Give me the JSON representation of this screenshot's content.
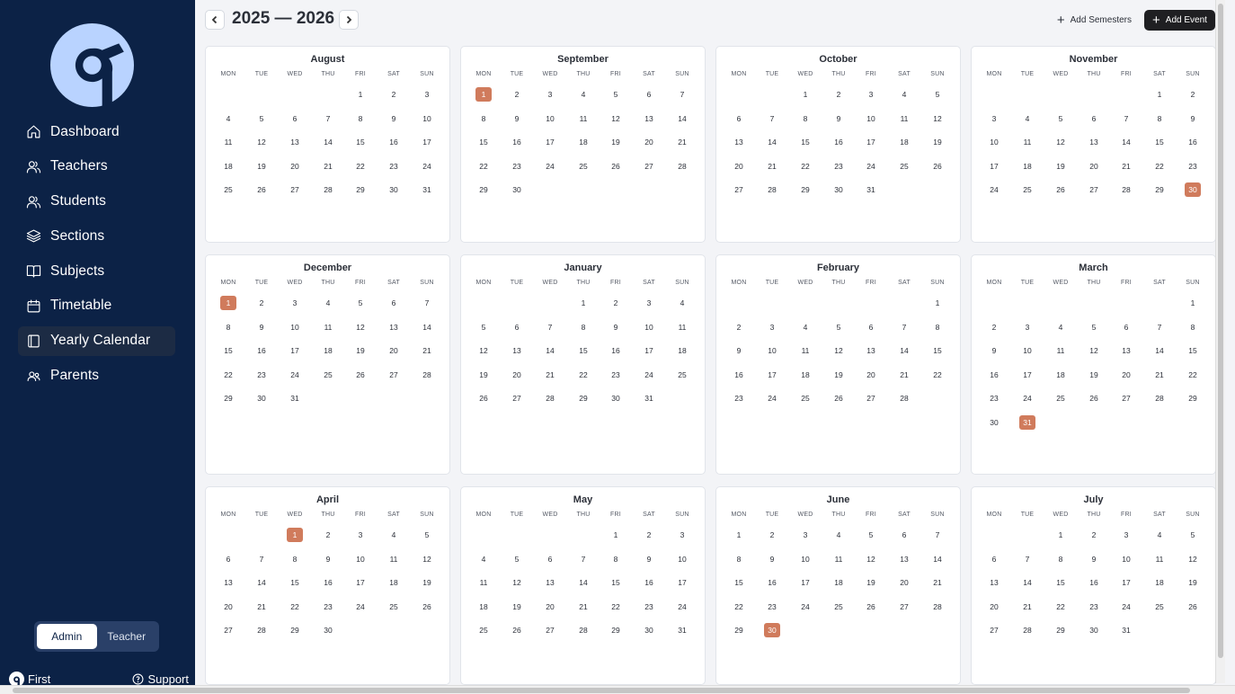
{
  "sidebar": {
    "items": [
      {
        "label": "Dashboard",
        "icon": "home-icon"
      },
      {
        "label": "Teachers",
        "icon": "users-icon"
      },
      {
        "label": "Students",
        "icon": "users-icon"
      },
      {
        "label": "Sections",
        "icon": "layers-icon"
      },
      {
        "label": "Subjects",
        "icon": "book-open-icon"
      },
      {
        "label": "Timetable",
        "icon": "calendar-icon"
      },
      {
        "label": "Yearly Calendar",
        "icon": "book-icon",
        "active": true
      },
      {
        "label": "Parents",
        "icon": "user-group-icon"
      }
    ],
    "role_toggle": {
      "admin": "Admin",
      "teacher": "Teacher",
      "selected": "Admin"
    },
    "footer": {
      "brand": "First",
      "support": "Support"
    }
  },
  "header": {
    "year_range": "2025 — 2026",
    "add_semesters": "Add Semesters",
    "add_event": "Add Event"
  },
  "weekdays": [
    "MON",
    "TUE",
    "WED",
    "THU",
    "FRI",
    "SAT",
    "SUN"
  ],
  "colors": {
    "sidebar": "#0c2246",
    "highlight": "#d07b5c",
    "primary_button": "#1f1f22"
  },
  "months": [
    {
      "name": "August",
      "offset": 4,
      "days": 31,
      "highlight": []
    },
    {
      "name": "September",
      "offset": 0,
      "days": 30,
      "highlight": [
        1
      ]
    },
    {
      "name": "October",
      "offset": 2,
      "days": 31,
      "highlight": []
    },
    {
      "name": "November",
      "offset": 5,
      "days": 30,
      "highlight": [
        30
      ]
    },
    {
      "name": "December",
      "offset": 0,
      "days": 31,
      "highlight": [
        1
      ]
    },
    {
      "name": "January",
      "offset": 3,
      "days": 31,
      "highlight": []
    },
    {
      "name": "February",
      "offset": 6,
      "days": 28,
      "highlight": []
    },
    {
      "name": "March",
      "offset": 6,
      "days": 31,
      "highlight": [
        31
      ]
    },
    {
      "name": "April",
      "offset": 2,
      "days": 30,
      "highlight": [
        1
      ]
    },
    {
      "name": "May",
      "offset": 4,
      "days": 31,
      "highlight": []
    },
    {
      "name": "June",
      "offset": 0,
      "days": 30,
      "highlight": [
        30
      ]
    },
    {
      "name": "July",
      "offset": 2,
      "days": 31,
      "highlight": []
    }
  ]
}
